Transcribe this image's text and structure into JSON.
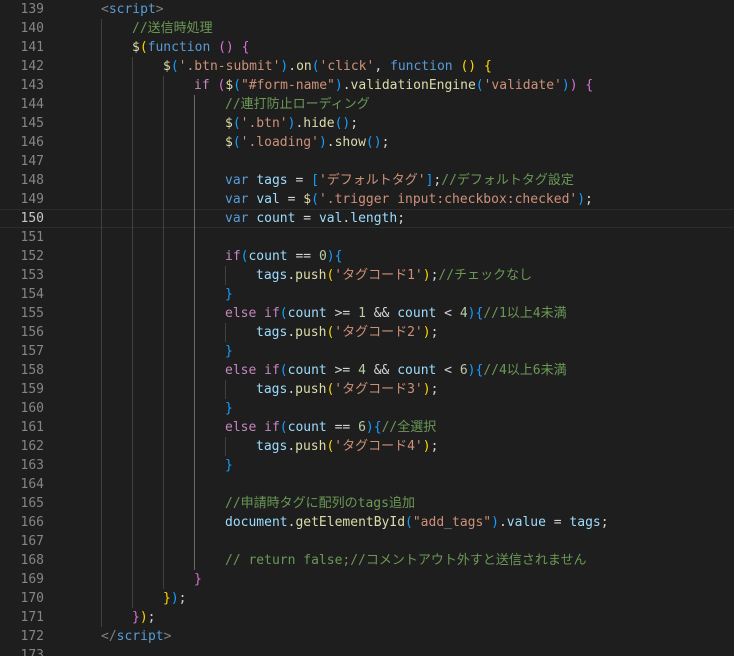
{
  "editor": {
    "current_line": 150,
    "lines": [
      {
        "n": 139,
        "indent": 1,
        "tokens": [
          [
            "tagb",
            "<"
          ],
          [
            "tag",
            "script"
          ],
          [
            "tagb",
            ">"
          ]
        ]
      },
      {
        "n": 140,
        "indent": 2,
        "tokens": [
          [
            "cm",
            "//送信時処理"
          ]
        ]
      },
      {
        "n": 141,
        "indent": 2,
        "tokens": [
          [
            "fn",
            "$"
          ],
          [
            "b1",
            "("
          ],
          [
            "kw",
            "function"
          ],
          [
            "pl",
            " "
          ],
          [
            "b2",
            "()"
          ],
          [
            "pl",
            " "
          ],
          [
            "b2",
            "{"
          ]
        ]
      },
      {
        "n": 142,
        "indent": 3,
        "tokens": [
          [
            "fn",
            "$"
          ],
          [
            "b3",
            "("
          ],
          [
            "str",
            "'.btn-submit'"
          ],
          [
            "b3",
            ")"
          ],
          [
            "pl",
            "."
          ],
          [
            "fn",
            "on"
          ],
          [
            "b3",
            "("
          ],
          [
            "str",
            "'click'"
          ],
          [
            "pl",
            ", "
          ],
          [
            "kw",
            "function"
          ],
          [
            "pl",
            " "
          ],
          [
            "b1",
            "()"
          ],
          [
            "pl",
            " "
          ],
          [
            "b1",
            "{"
          ]
        ]
      },
      {
        "n": 143,
        "indent": 4,
        "tokens": [
          [
            "ctl",
            "if"
          ],
          [
            "pl",
            " "
          ],
          [
            "b2",
            "("
          ],
          [
            "fn",
            "$"
          ],
          [
            "b3",
            "("
          ],
          [
            "str",
            "\"#form-name\""
          ],
          [
            "b3",
            ")"
          ],
          [
            "pl",
            "."
          ],
          [
            "fn",
            "validationEngine"
          ],
          [
            "b3",
            "("
          ],
          [
            "str",
            "'validate'"
          ],
          [
            "b3",
            ")"
          ],
          [
            "b2",
            ")"
          ],
          [
            "pl",
            " "
          ],
          [
            "b2",
            "{"
          ]
        ]
      },
      {
        "n": 144,
        "indent": 5,
        "tokens": [
          [
            "cm",
            "//連打防止ローディング"
          ]
        ]
      },
      {
        "n": 145,
        "indent": 5,
        "tokens": [
          [
            "fn",
            "$"
          ],
          [
            "b3",
            "("
          ],
          [
            "str",
            "'.btn'"
          ],
          [
            "b3",
            ")"
          ],
          [
            "pl",
            "."
          ],
          [
            "fn",
            "hide"
          ],
          [
            "b3",
            "()"
          ],
          [
            "pl",
            ";"
          ]
        ]
      },
      {
        "n": 146,
        "indent": 5,
        "tokens": [
          [
            "fn",
            "$"
          ],
          [
            "b3",
            "("
          ],
          [
            "str",
            "'.loading'"
          ],
          [
            "b3",
            ")"
          ],
          [
            "pl",
            "."
          ],
          [
            "fn",
            "show"
          ],
          [
            "b3",
            "()"
          ],
          [
            "pl",
            ";"
          ]
        ]
      },
      {
        "n": 147,
        "indent": 5,
        "tokens": []
      },
      {
        "n": 148,
        "indent": 5,
        "tokens": [
          [
            "kw",
            "var"
          ],
          [
            "pl",
            " "
          ],
          [
            "var",
            "tags"
          ],
          [
            "pl",
            " = "
          ],
          [
            "b3",
            "["
          ],
          [
            "str",
            "'デフォルトタグ'"
          ],
          [
            "b3",
            "]"
          ],
          [
            "pl",
            ";"
          ],
          [
            "cm",
            "//デフォルトタグ設定"
          ]
        ]
      },
      {
        "n": 149,
        "indent": 5,
        "tokens": [
          [
            "kw",
            "var"
          ],
          [
            "pl",
            " "
          ],
          [
            "var",
            "val"
          ],
          [
            "pl",
            " = "
          ],
          [
            "fn",
            "$"
          ],
          [
            "b3",
            "("
          ],
          [
            "str",
            "'.trigger input:checkbox:checked'"
          ],
          [
            "b3",
            ")"
          ],
          [
            "pl",
            ";"
          ]
        ]
      },
      {
        "n": 150,
        "indent": 5,
        "tokens": [
          [
            "kw",
            "var"
          ],
          [
            "pl",
            " "
          ],
          [
            "var",
            "count"
          ],
          [
            "pl",
            " = "
          ],
          [
            "var",
            "val"
          ],
          [
            "pl",
            "."
          ],
          [
            "var",
            "length"
          ],
          [
            "pl",
            ";"
          ]
        ]
      },
      {
        "n": 151,
        "indent": 5,
        "tokens": []
      },
      {
        "n": 152,
        "indent": 5,
        "tokens": [
          [
            "ctl",
            "if"
          ],
          [
            "b3",
            "("
          ],
          [
            "var",
            "count"
          ],
          [
            "pl",
            " == "
          ],
          [
            "num",
            "0"
          ],
          [
            "b3",
            ")"
          ],
          [
            "b3",
            "{"
          ]
        ]
      },
      {
        "n": 153,
        "indent": 6,
        "tokens": [
          [
            "var",
            "tags"
          ],
          [
            "pl",
            "."
          ],
          [
            "fn",
            "push"
          ],
          [
            "b1",
            "("
          ],
          [
            "str",
            "'タグコード1'"
          ],
          [
            "b1",
            ")"
          ],
          [
            "pl",
            ";"
          ],
          [
            "cm",
            "//チェックなし"
          ]
        ]
      },
      {
        "n": 154,
        "indent": 5,
        "tokens": [
          [
            "b3",
            "}"
          ]
        ]
      },
      {
        "n": 155,
        "indent": 5,
        "tokens": [
          [
            "ctl",
            "else"
          ],
          [
            "pl",
            " "
          ],
          [
            "ctl",
            "if"
          ],
          [
            "b3",
            "("
          ],
          [
            "var",
            "count"
          ],
          [
            "pl",
            " >= "
          ],
          [
            "num",
            "1"
          ],
          [
            "pl",
            " && "
          ],
          [
            "var",
            "count"
          ],
          [
            "pl",
            " < "
          ],
          [
            "num",
            "4"
          ],
          [
            "b3",
            ")"
          ],
          [
            "b3",
            "{"
          ],
          [
            "cm",
            "//1以上4未満"
          ]
        ]
      },
      {
        "n": 156,
        "indent": 6,
        "tokens": [
          [
            "var",
            "tags"
          ],
          [
            "pl",
            "."
          ],
          [
            "fn",
            "push"
          ],
          [
            "b1",
            "("
          ],
          [
            "str",
            "'タグコード2'"
          ],
          [
            "b1",
            ")"
          ],
          [
            "pl",
            ";"
          ]
        ]
      },
      {
        "n": 157,
        "indent": 5,
        "tokens": [
          [
            "b3",
            "}"
          ]
        ]
      },
      {
        "n": 158,
        "indent": 5,
        "tokens": [
          [
            "ctl",
            "else"
          ],
          [
            "pl",
            " "
          ],
          [
            "ctl",
            "if"
          ],
          [
            "b3",
            "("
          ],
          [
            "var",
            "count"
          ],
          [
            "pl",
            " >= "
          ],
          [
            "num",
            "4"
          ],
          [
            "pl",
            " && "
          ],
          [
            "var",
            "count"
          ],
          [
            "pl",
            " < "
          ],
          [
            "num",
            "6"
          ],
          [
            "b3",
            ")"
          ],
          [
            "b3",
            "{"
          ],
          [
            "cm",
            "//4以上6未満"
          ]
        ]
      },
      {
        "n": 159,
        "indent": 6,
        "tokens": [
          [
            "var",
            "tags"
          ],
          [
            "pl",
            "."
          ],
          [
            "fn",
            "push"
          ],
          [
            "b1",
            "("
          ],
          [
            "str",
            "'タグコード3'"
          ],
          [
            "b1",
            ")"
          ],
          [
            "pl",
            ";"
          ]
        ]
      },
      {
        "n": 160,
        "indent": 5,
        "tokens": [
          [
            "b3",
            "}"
          ]
        ]
      },
      {
        "n": 161,
        "indent": 5,
        "tokens": [
          [
            "ctl",
            "else"
          ],
          [
            "pl",
            " "
          ],
          [
            "ctl",
            "if"
          ],
          [
            "b3",
            "("
          ],
          [
            "var",
            "count"
          ],
          [
            "pl",
            " == "
          ],
          [
            "num",
            "6"
          ],
          [
            "b3",
            ")"
          ],
          [
            "b3",
            "{"
          ],
          [
            "cm",
            "//全選択"
          ]
        ]
      },
      {
        "n": 162,
        "indent": 6,
        "tokens": [
          [
            "var",
            "tags"
          ],
          [
            "pl",
            "."
          ],
          [
            "fn",
            "push"
          ],
          [
            "b1",
            "("
          ],
          [
            "str",
            "'タグコード4'"
          ],
          [
            "b1",
            ")"
          ],
          [
            "pl",
            ";"
          ]
        ]
      },
      {
        "n": 163,
        "indent": 5,
        "tokens": [
          [
            "b3",
            "}"
          ]
        ]
      },
      {
        "n": 164,
        "indent": 5,
        "tokens": []
      },
      {
        "n": 165,
        "indent": 5,
        "tokens": [
          [
            "cm",
            "//申請時タグに配列のtags追加"
          ]
        ]
      },
      {
        "n": 166,
        "indent": 5,
        "tokens": [
          [
            "var",
            "document"
          ],
          [
            "pl",
            "."
          ],
          [
            "fn",
            "getElementById"
          ],
          [
            "b3",
            "("
          ],
          [
            "str",
            "\"add_tags\""
          ],
          [
            "b3",
            ")"
          ],
          [
            "pl",
            "."
          ],
          [
            "var",
            "value"
          ],
          [
            "pl",
            " = "
          ],
          [
            "var",
            "tags"
          ],
          [
            "pl",
            ";"
          ]
        ]
      },
      {
        "n": 167,
        "indent": 5,
        "tokens": []
      },
      {
        "n": 168,
        "indent": 5,
        "tokens": [
          [
            "cm",
            "// return false;//コメントアウト外すと送信されません"
          ]
        ]
      },
      {
        "n": 169,
        "indent": 4,
        "tokens": [
          [
            "b2",
            "}"
          ]
        ]
      },
      {
        "n": 170,
        "indent": 3,
        "tokens": [
          [
            "b1",
            "}"
          ],
          [
            "b3",
            ")"
          ],
          [
            "pl",
            ";"
          ]
        ]
      },
      {
        "n": 171,
        "indent": 2,
        "tokens": [
          [
            "b2",
            "}"
          ],
          [
            "b1",
            ")"
          ],
          [
            "pl",
            ";"
          ]
        ]
      },
      {
        "n": 172,
        "indent": 1,
        "tokens": [
          [
            "tagb",
            "</"
          ],
          [
            "tag",
            "script"
          ],
          [
            "tagb",
            ">"
          ]
        ]
      },
      {
        "n": 173,
        "indent": 1,
        "tokens": []
      }
    ]
  }
}
